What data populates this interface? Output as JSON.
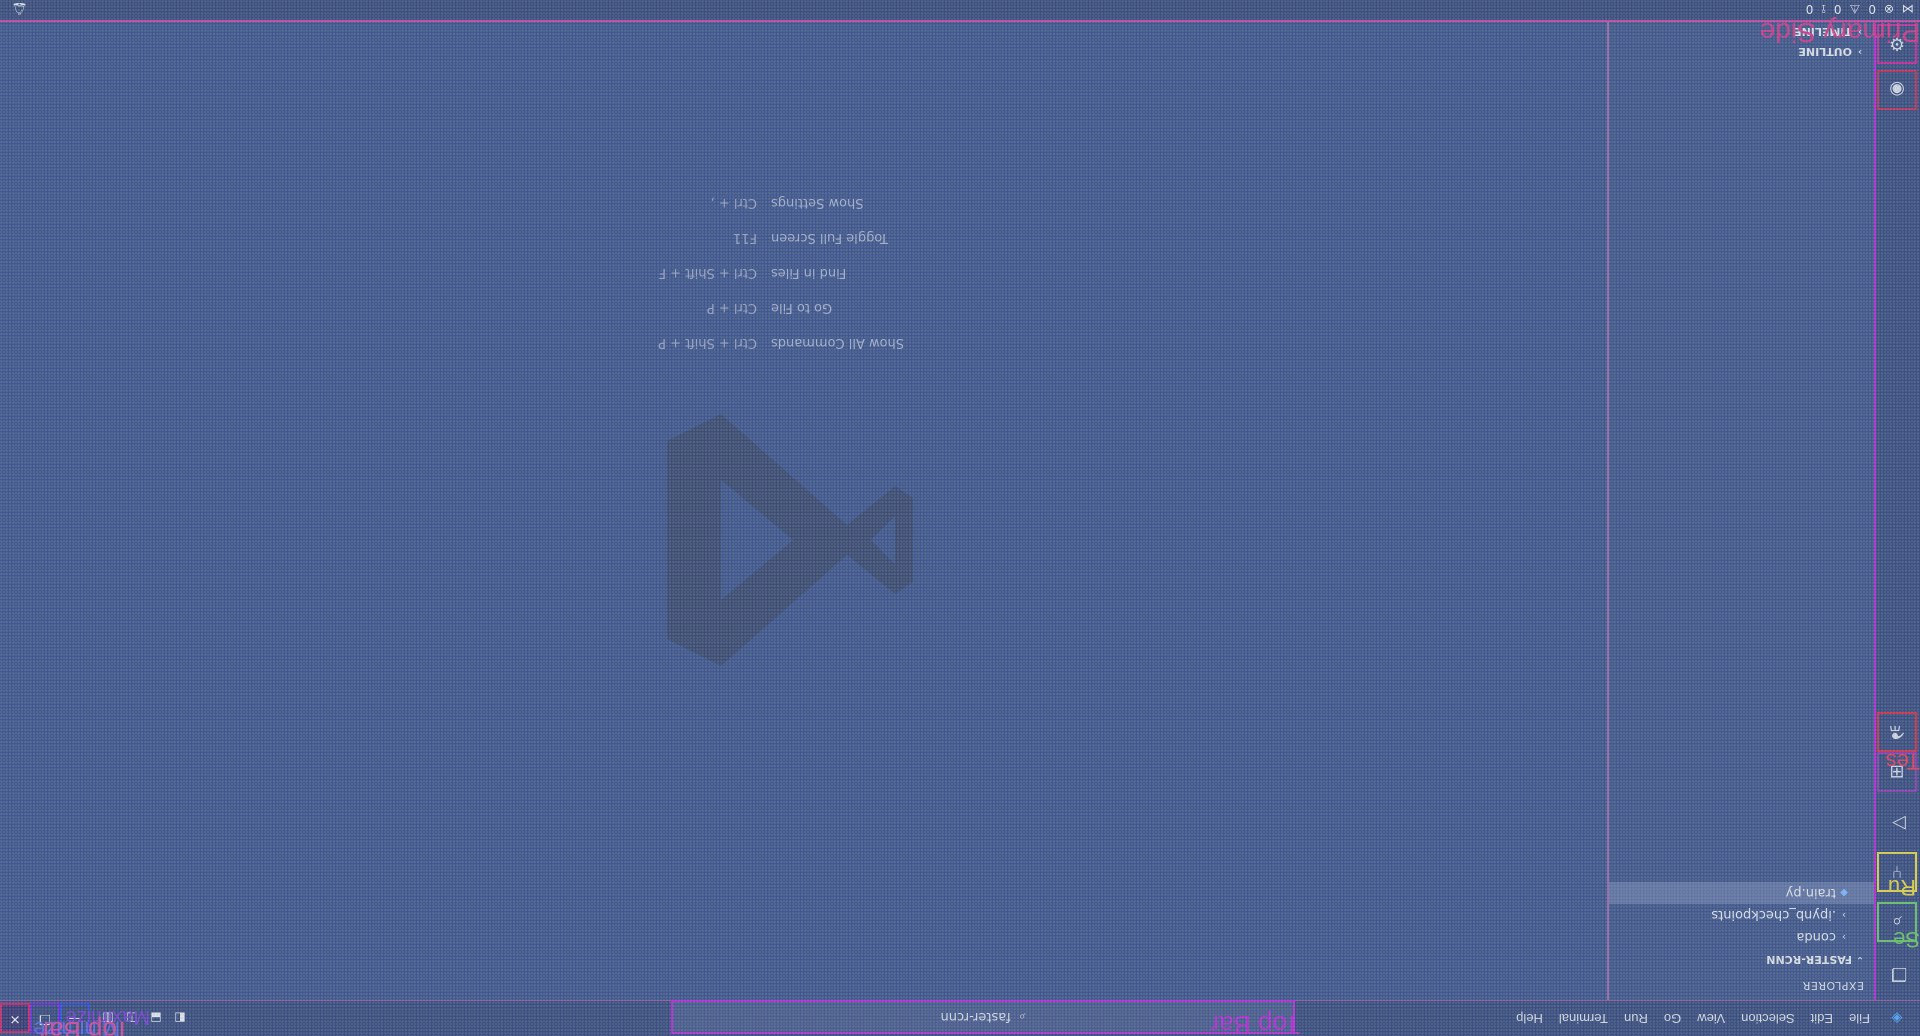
{
  "title_bar": {
    "menu": [
      "File",
      "Edit",
      "Selection",
      "View",
      "Go",
      "Run",
      "Terminal",
      "Help"
    ],
    "command_center_text": "faster-rcnn",
    "window_buttons": [
      "minimize",
      "maximize",
      "close"
    ]
  },
  "overlay_labels": {
    "top_bar": "Top Bar",
    "primary_side": "Primary Side",
    "minimize": "Minimize",
    "maximize": "Maximize",
    "test": "Tes",
    "run": "Ru",
    "search": "Se"
  },
  "activity_bar": {
    "items": [
      {
        "name": "explorer",
        "icon": "files-icon"
      },
      {
        "name": "search",
        "icon": "search-icon"
      },
      {
        "name": "source-control",
        "icon": "source-control-icon"
      },
      {
        "name": "run-debug",
        "icon": "run-debug-icon"
      },
      {
        "name": "extensions",
        "icon": "extensions-icon"
      },
      {
        "name": "testing",
        "icon": "testing-icon"
      },
      {
        "name": "accounts",
        "icon": "account-icon"
      },
      {
        "name": "manage",
        "icon": "gear-icon"
      }
    ]
  },
  "sidebar": {
    "header": "EXPLORER",
    "section_title": "FASTER-RCNN",
    "items": [
      {
        "label": "conda",
        "type": "folder"
      },
      {
        "label": ".ipynb_checkpoints",
        "type": "folder"
      },
      {
        "label": "train.py",
        "type": "file",
        "active": true
      }
    ],
    "bottom_sections": [
      "OUTLINE",
      "TIMELINE"
    ]
  },
  "editor": {
    "shortcuts": [
      {
        "label": "Show All Commands",
        "keys": "Ctrl + Shift + P"
      },
      {
        "label": "Go to File",
        "keys": "Ctrl + P"
      },
      {
        "label": "Find in Files",
        "keys": "Ctrl + Shift + F"
      },
      {
        "label": "Toggle Full Screen",
        "keys": "F11"
      },
      {
        "label": "Show Settings",
        "keys": "Ctrl + ,"
      }
    ]
  },
  "status_bar": {
    "errors": "0",
    "warnings": "0",
    "ports": "0"
  }
}
